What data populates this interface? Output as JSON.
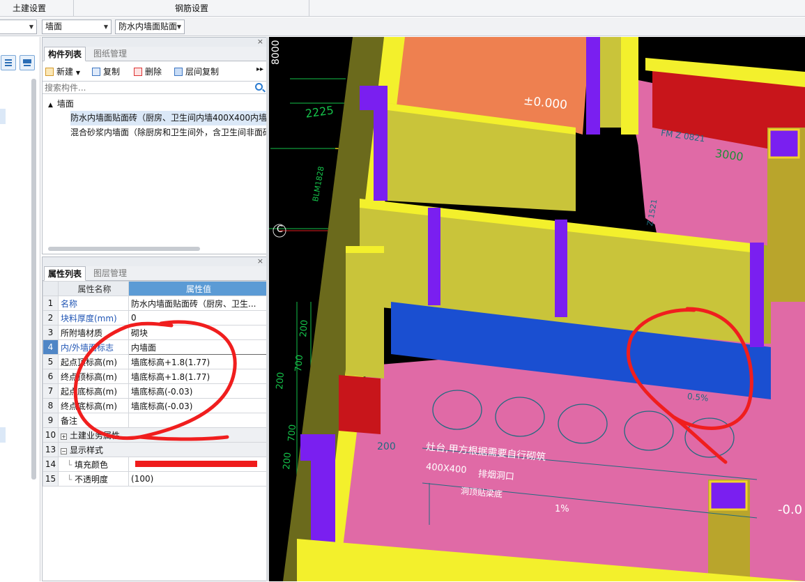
{
  "topbar": {
    "tab1": "土建设置",
    "tab2": "钢筋设置"
  },
  "toolbar": {
    "combo1_value": "",
    "combo2_value": "墙面",
    "combo3_value": "防水内墙面贴面"
  },
  "component_panel": {
    "tab_list": "构件列表",
    "tab_drawing": "图纸管理",
    "btn_new": "新建",
    "btn_copy": "复制",
    "btn_delete": "删除",
    "btn_floor_copy": "层间复制",
    "search_placeholder": "搜索构件...",
    "tree_root": "墙面",
    "items": [
      "防水内墙面贴面砖（厨房、卫生间内墙400X400内墙",
      "混合砂浆内墙面（除厨房和卫生间外，含卫生间非面砖"
    ]
  },
  "property_panel": {
    "tab_props": "属性列表",
    "tab_layers": "图层管理",
    "col_name": "属性名称",
    "col_value": "属性值",
    "rows": [
      {
        "num": "1",
        "name": "名称",
        "value": "防水内墙面贴面砖（厨房、卫生..."
      },
      {
        "num": "2",
        "name": "块料厚度(mm)",
        "value": "0"
      },
      {
        "num": "3",
        "name": "所附墙材质",
        "value": "砌块"
      },
      {
        "num": "4",
        "name": "内/外墙面标志",
        "value": "内墙面"
      },
      {
        "num": "5",
        "name": "起点顶标高(m)",
        "value": "墙底标高+1.8(1.77)"
      },
      {
        "num": "6",
        "name": "终点顶标高(m)",
        "value": "墙底标高+1.8(1.77)"
      },
      {
        "num": "7",
        "name": "起点底标高(m)",
        "value": "墙底标高(-0.03)"
      },
      {
        "num": "8",
        "name": "终点底标高(m)",
        "value": "墙底标高(-0.03)"
      },
      {
        "num": "9",
        "name": "备注",
        "value": ""
      },
      {
        "num": "10",
        "name": "土建业务属性",
        "value": ""
      },
      {
        "num": "13",
        "name": "显示样式",
        "value": ""
      },
      {
        "num": "14",
        "name": "填充颜色",
        "value": ""
      },
      {
        "num": "15",
        "name": "不透明度",
        "value": "(100)"
      }
    ],
    "fill_color": "#ef1c1c"
  },
  "viewport": {
    "labels": {
      "dim_8000": "8000",
      "dim_2225": "2225",
      "elev_000": "±0.000",
      "door_fm": "FM Z 0821",
      "dim_3000": "3000",
      "blm": "BLM1828",
      "dim_1521": "Z 1521",
      "axis_c": "C",
      "dim_200a": "200",
      "dim_700a": "700",
      "dim_200b": "200",
      "dim_700b": "700",
      "dim_200c": "200",
      "dim_200d": "200",
      "slope_05": "0.5%",
      "note_stove": "灶台,甲方根据需要自行砌筑",
      "note_size": "400X400",
      "note_vent": "排烟洞口",
      "note_beam": "洞顶贴梁底",
      "slope_1": "1%",
      "elev_neg": "-0.0"
    },
    "colors": {
      "wall": "#c9c43a",
      "wall_top": "#f3f02c",
      "column": "#7a1ff0",
      "floor": "#e06aa6",
      "blue_face": "#1a4fd1",
      "red_face": "#c8151b",
      "orange_floor": "#ee8050",
      "annotation": "#f01e1e"
    }
  }
}
